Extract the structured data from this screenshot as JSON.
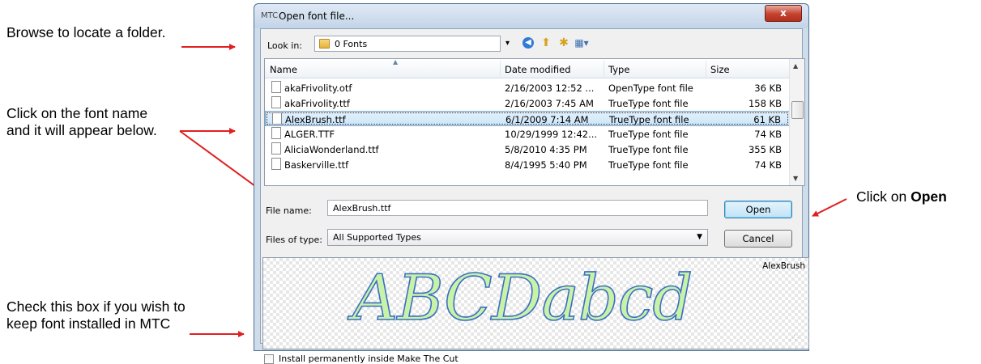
{
  "annotations": {
    "browse": "Browse to locate a folder.",
    "click_font": "Click on the font name and it will appear below.",
    "click_open_prefix": "Click on ",
    "click_open_bold": "Open",
    "check_box": "Check this box if you wish to keep font installed in MTC",
    "arrow_color": "#e02020"
  },
  "dialog": {
    "title": "Open font file...",
    "close_label": "x",
    "look_in_label": "Look in:",
    "look_in_value": "0 Fonts",
    "toolbar_icons": [
      "back-icon",
      "up-folder-icon",
      "new-folder-icon",
      "views-menu-icon"
    ],
    "columns": [
      "Name",
      "Date modified",
      "Type",
      "Size"
    ],
    "files": [
      {
        "name": "akaFrivolity.otf",
        "date": "2/16/2003 12:52 ...",
        "type": "OpenType font file",
        "size": "36 KB",
        "selected": false
      },
      {
        "name": "akaFrivolity.ttf",
        "date": "2/16/2003 7:45 AM",
        "type": "TrueType font file",
        "size": "158 KB",
        "selected": false
      },
      {
        "name": "AlexBrush.ttf",
        "date": "6/1/2009 7:14 AM",
        "type": "TrueType font file",
        "size": "61 KB",
        "selected": true
      },
      {
        "name": "ALGER.TTF",
        "date": "10/29/1999 12:42...",
        "type": "TrueType font file",
        "size": "74 KB",
        "selected": false
      },
      {
        "name": "AliciaWonderland.ttf",
        "date": "5/8/2010 4:35 PM",
        "type": "TrueType font file",
        "size": "355 KB",
        "selected": false
      },
      {
        "name": "Baskerville.ttf",
        "date": "8/4/1995 5:40 PM",
        "type": "TrueType font file",
        "size": "74 KB",
        "selected": false
      }
    ],
    "file_name_label": "File name:",
    "file_name_value": "AlexBrush.ttf",
    "files_of_type_label": "Files of type:",
    "files_of_type_value": "All Supported Types",
    "open_label": "Open",
    "cancel_label": "Cancel",
    "preview_font_name": "AlexBrush",
    "preview_text": "ABCDabcd",
    "install_label": "Install permanently inside Make The Cut",
    "install_checked": false
  }
}
